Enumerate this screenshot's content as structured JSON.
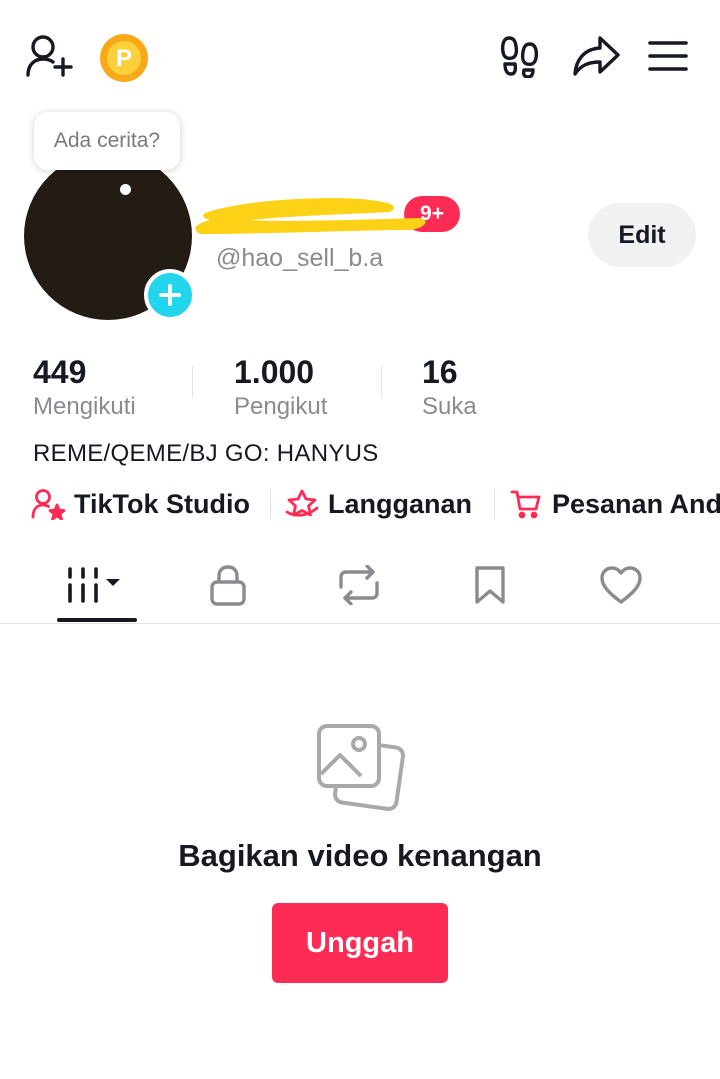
{
  "colors": {
    "accent": "#fe2c55",
    "avatar_add": "#20d5ec",
    "coin": "#f8a91a",
    "text_primary": "#161823",
    "text_secondary": "#8a8b91",
    "redaction": "#fcd116"
  },
  "header": {
    "icons": [
      "add-user-icon",
      "coin-icon",
      "footprints-icon",
      "share-icon",
      "menu-icon"
    ],
    "coin_letter": "P"
  },
  "story": {
    "prompt": "Ada cerita?"
  },
  "profile": {
    "notification_badge": "9+",
    "username": "@hao_sell_b.a",
    "edit_label": "Edit",
    "bio": "REME/QEME/BJ GO: HANYUS"
  },
  "stats": [
    {
      "value": "449",
      "label": "Mengikuti"
    },
    {
      "value": "1.000",
      "label": "Pengikut"
    },
    {
      "value": "16",
      "label": "Suka"
    }
  ],
  "links": [
    {
      "label": "TikTok Studio",
      "icon": "person-star-icon"
    },
    {
      "label": "Langganan",
      "icon": "subscription-star-icon"
    },
    {
      "label": "Pesanan And",
      "icon": "cart-icon"
    }
  ],
  "tabs": [
    {
      "name": "videos",
      "icon": "grid-icon",
      "selected": true
    },
    {
      "name": "private",
      "icon": "lock-icon"
    },
    {
      "name": "reposts",
      "icon": "repost-icon"
    },
    {
      "name": "favorites",
      "icon": "bookmark-icon"
    },
    {
      "name": "liked",
      "icon": "heart-icon"
    }
  ],
  "empty_state": {
    "icon": "photos-icon",
    "title": "Bagikan video kenangan",
    "button_label": "Unggah"
  }
}
